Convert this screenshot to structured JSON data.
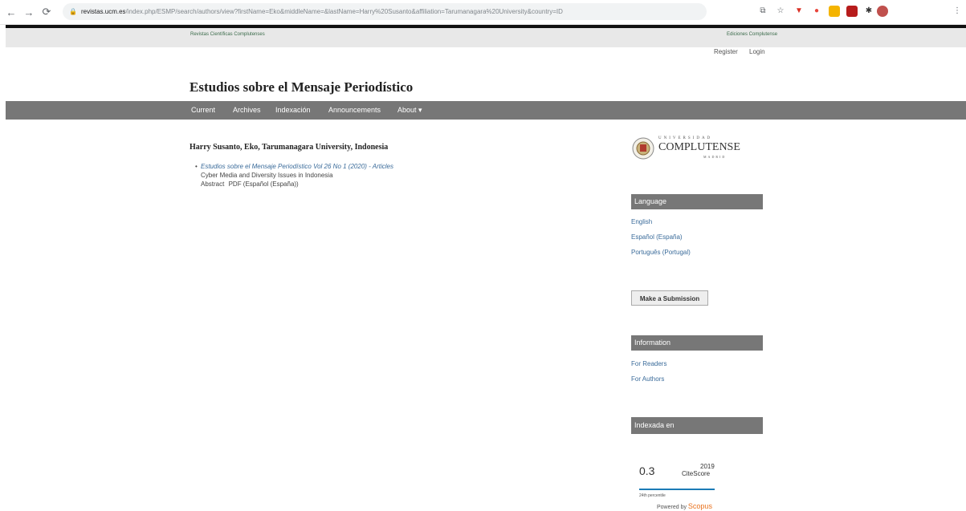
{
  "browser": {
    "url_host": "revistas.ucm.es",
    "url_path": "/index.php/ESMP/search/authors/view?firstName=Eko&middleName=&lastName=Harry%20Susanto&affiliation=Tarumanagara%20University&country=ID"
  },
  "topbar": {
    "left_link": "Revistas Científicas Complutenses",
    "right_link": "Ediciones Complutense"
  },
  "user": {
    "register": "Register",
    "login": "Login"
  },
  "site_title": "Estudios sobre el Mensaje Periodístico",
  "nav": {
    "items": [
      "Current",
      "Archives",
      "Indexación",
      "Announcements",
      "About ▾"
    ]
  },
  "author": {
    "heading": "Harry Susanto, Eko, Tarumanagara University, Indonesia",
    "articles": [
      {
        "issue": "Estudios sobre el Mensaje Periodístico Vol 26 No 1 (2020) - Articles",
        "title": "Cyber Media and Diversity Issues in Indonesia",
        "abstract": "Abstract",
        "pdf": "PDF (Español (España))"
      }
    ]
  },
  "sidebar": {
    "logo_top": "UNIVERSIDAD",
    "logo_main": "COMPLUTENSE",
    "logo_bottom": "MADRID",
    "language_heading": "Language",
    "languages": [
      "English",
      "Español (España)",
      "Português (Portugal)"
    ],
    "submit_label": "Make a Submission",
    "info_heading": "Information",
    "info_links": [
      "For Readers",
      "For Authors"
    ],
    "indexed_heading": "Indexada en",
    "citescore": {
      "value": "0.3",
      "year": "2019",
      "label": "CiteScore",
      "percentile": "24th percentile",
      "powered": "Powered by",
      "brand": "Scopus"
    }
  },
  "colors": {
    "accent_link": "#3a6b9a",
    "nav_bg": "#777777"
  }
}
